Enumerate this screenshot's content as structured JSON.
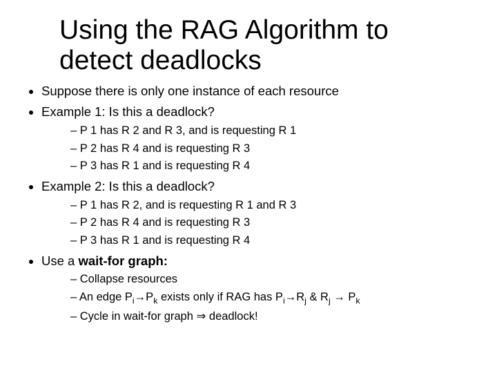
{
  "title_l1": "Using the RAG Algorithm to",
  "title_l2": "detect deadlocks",
  "b1": "Suppose there is only one instance of each resource",
  "b2": "Example 1: Is this a deadlock?",
  "b2s1": "P 1 has R 2 and R 3, and  is requesting R 1",
  "b2s2": "P 2 has R 4 and is requesting R 3",
  "b2s3": "P 3 has R 1 and is requesting R 4",
  "b3": "Example 2: Is this a deadlock?",
  "b3s1": "P 1 has R 2, and  is requesting R 1 and R 3",
  "b3s2": "P 2 has R 4 and is requesting R 3",
  "b3s3": "P 3 has R 1 and is requesting R 4",
  "b4_pre": "Use a ",
  "b4_bold": "wait-for graph:",
  "b4s1": "Collapse resources",
  "b4s2_a": "An edge P",
  "b4s2_i": "i",
  "b4s2_b": "→P",
  "b4s2_k": "k",
  "b4s2_c": " exists only if RAG has P",
  "b4s2_i2": "i",
  "b4s2_d": "→R",
  "b4s2_j": "j",
  "b4s2_e": " & R",
  "b4s2_j2": "j",
  "b4s2_f": " → P",
  "b4s2_k2": "k",
  "b4s3": "Cycle in wait-for graph ⇒ deadlock!"
}
